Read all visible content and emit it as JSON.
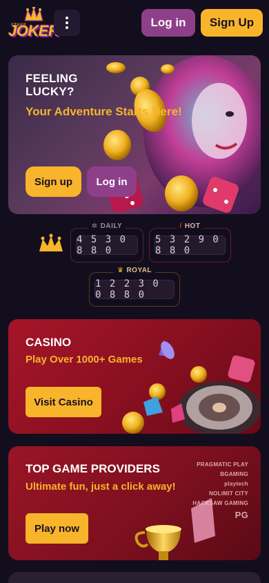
{
  "header": {
    "logo_small": "STAKE",
    "logo_main": "JOKER",
    "menu_icon": "more-vertical-icon",
    "login_label": "Log in",
    "signup_label": "Sign Up"
  },
  "hero": {
    "title_line1": "FEELING",
    "title_line2": "LUCKY?",
    "subtitle": "Your Adventure Starts Here!",
    "signup_label": "Sign up",
    "login_label": "Log in"
  },
  "jackpots": {
    "daily": {
      "label": "DAILY",
      "value": "4 5 3 0 8 8 0"
    },
    "hot": {
      "label": "HOT",
      "value": "5 3 2 9 0 8 8 0"
    },
    "royal": {
      "label": "ROYAL",
      "value": "1 2 2 3 0 0 8 8 0"
    }
  },
  "casino": {
    "title": "CASINO",
    "subtitle": "Play Over 1000+ Games",
    "button_label": "Visit Casino"
  },
  "providers": {
    "title": "TOP GAME PROVIDERS",
    "subtitle": "Ultimate fun, just a click away!",
    "button_label": "Play now",
    "logos": [
      "PRAGMATIC PLAY",
      "BGAMING",
      "playtech",
      "NOLIMIT CITY",
      "HACKSAW GAMING",
      "PG"
    ]
  },
  "colors": {
    "accent": "#f8b42a",
    "secondary": "#8e3f8a",
    "background": "#130e1d",
    "card_red": "#a6152a"
  }
}
